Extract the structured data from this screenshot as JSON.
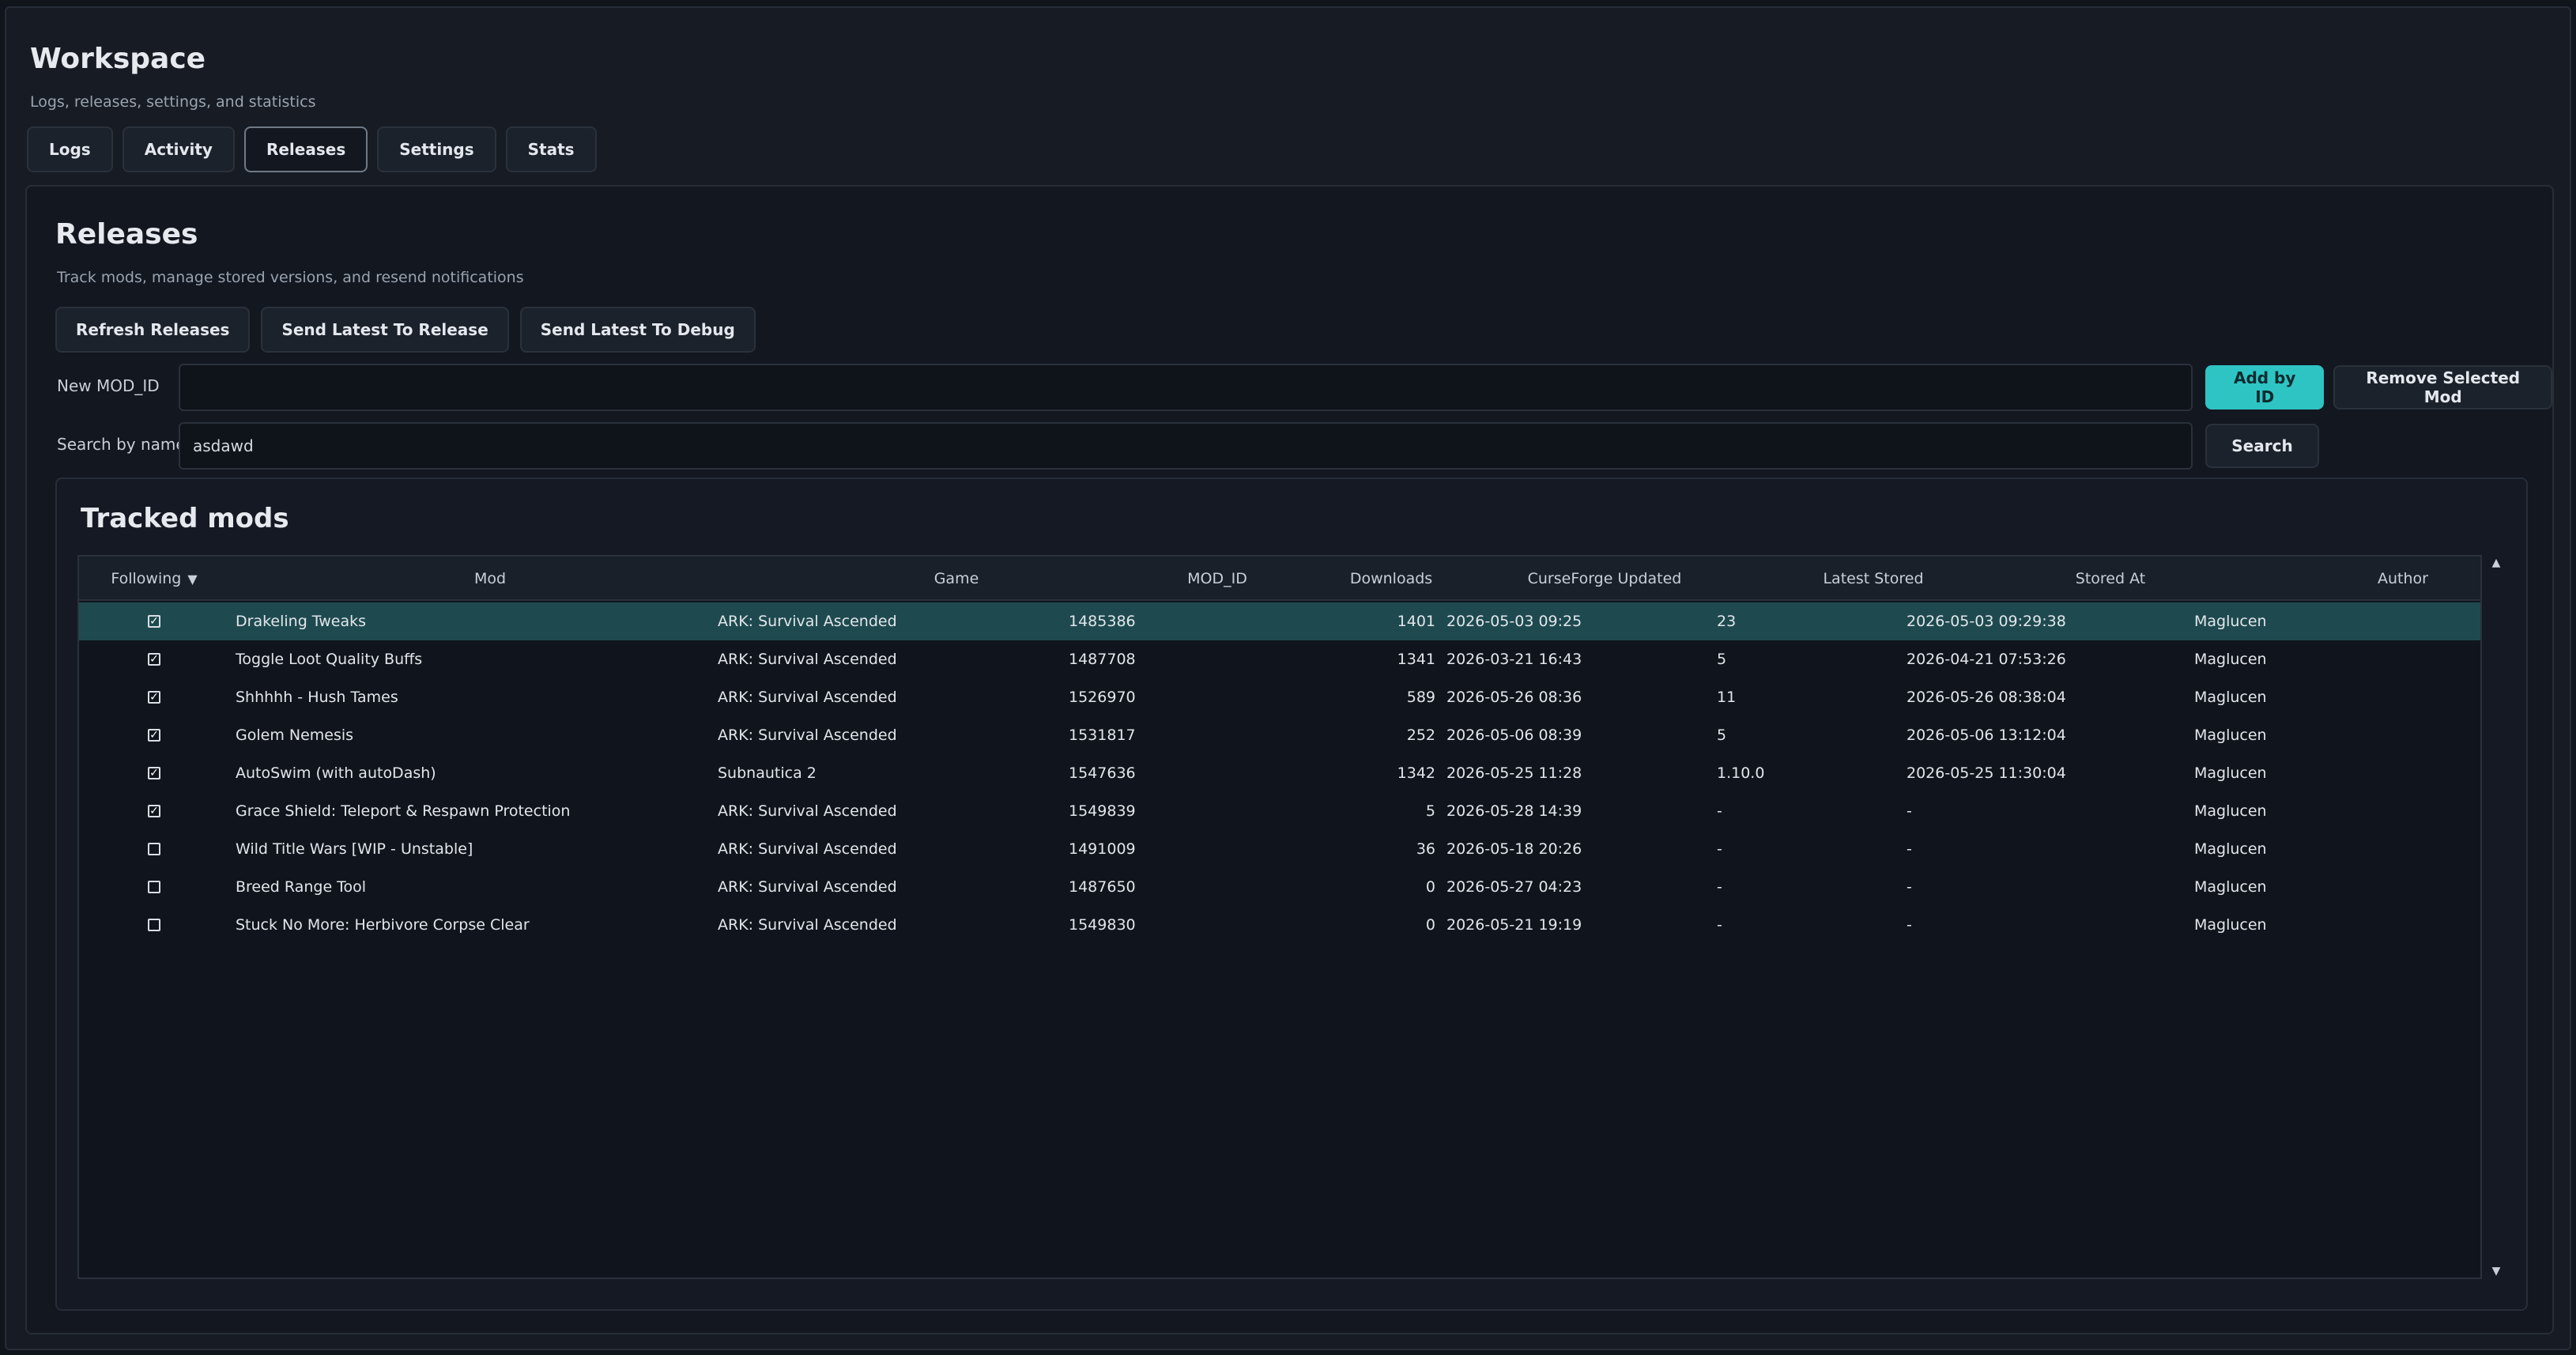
{
  "workspace": {
    "title": "Workspace",
    "subtitle": "Logs, releases, settings, and statistics"
  },
  "tabs": [
    {
      "label": "Logs",
      "active": false
    },
    {
      "label": "Activity",
      "active": false
    },
    {
      "label": "Releases",
      "active": true
    },
    {
      "label": "Settings",
      "active": false
    },
    {
      "label": "Stats",
      "active": false
    }
  ],
  "releases": {
    "title": "Releases",
    "subtitle": "Track mods, manage stored versions, and resend notifications",
    "actions": {
      "refresh": "Refresh Releases",
      "send_release": "Send Latest To Release",
      "send_debug": "Send Latest To Debug"
    },
    "new_mod": {
      "label": "New MOD_ID",
      "value": "",
      "add_button": "Add by ID",
      "remove_button": "Remove Selected Mod"
    },
    "search": {
      "label": "Search by name",
      "value": "asdawd",
      "button": "Search"
    }
  },
  "tracked": {
    "title": "Tracked mods",
    "columns": {
      "following": "Following",
      "sort_arrow": "▼",
      "mod": "Mod",
      "game": "Game",
      "mod_id": "MOD_ID",
      "downloads": "Downloads",
      "cf_updated": "CurseForge Updated",
      "latest_stored": "Latest Stored",
      "stored_at": "Stored At",
      "author": "Author"
    },
    "rows": [
      {
        "following": true,
        "mod": "Drakeling Tweaks",
        "game": "ARK: Survival Ascended",
        "mod_id": "1485386",
        "downloads": "1401",
        "cf_updated": "2026-05-03 09:25",
        "latest_stored": "23",
        "stored_at": "2026-05-03 09:29:38",
        "author": "Maglucen",
        "selected": true
      },
      {
        "following": true,
        "mod": "Toggle Loot Quality Buffs",
        "game": "ARK: Survival Ascended",
        "mod_id": "1487708",
        "downloads": "1341",
        "cf_updated": "2026-03-21 16:43",
        "latest_stored": "5",
        "stored_at": "2026-04-21 07:53:26",
        "author": "Maglucen",
        "selected": false
      },
      {
        "following": true,
        "mod": "Shhhhh - Hush Tames",
        "game": "ARK: Survival Ascended",
        "mod_id": "1526970",
        "downloads": "589",
        "cf_updated": "2026-05-26 08:36",
        "latest_stored": "11",
        "stored_at": "2026-05-26 08:38:04",
        "author": "Maglucen",
        "selected": false
      },
      {
        "following": true,
        "mod": "Golem Nemesis",
        "game": "ARK: Survival Ascended",
        "mod_id": "1531817",
        "downloads": "252",
        "cf_updated": "2026-05-06 08:39",
        "latest_stored": "5",
        "stored_at": "2026-05-06 13:12:04",
        "author": "Maglucen",
        "selected": false
      },
      {
        "following": true,
        "mod": "AutoSwim (with autoDash)",
        "game": "Subnautica 2",
        "mod_id": "1547636",
        "downloads": "1342",
        "cf_updated": "2026-05-25 11:28",
        "latest_stored": "1.10.0",
        "stored_at": "2026-05-25 11:30:04",
        "author": "Maglucen",
        "selected": false
      },
      {
        "following": true,
        "mod": "Grace Shield: Teleport & Respawn Protection",
        "game": "ARK: Survival Ascended",
        "mod_id": "1549839",
        "downloads": "5",
        "cf_updated": "2026-05-28 14:39",
        "latest_stored": "-",
        "stored_at": "-",
        "author": "Maglucen",
        "selected": false
      },
      {
        "following": false,
        "mod": "Wild Title Wars [WIP - Unstable]",
        "game": "ARK: Survival Ascended",
        "mod_id": "1491009",
        "downloads": "36",
        "cf_updated": "2026-05-18 20:26",
        "latest_stored": "-",
        "stored_at": "-",
        "author": "Maglucen",
        "selected": false
      },
      {
        "following": false,
        "mod": "Breed Range Tool",
        "game": "ARK: Survival Ascended",
        "mod_id": "1487650",
        "downloads": "0",
        "cf_updated": "2026-05-27 04:23",
        "latest_stored": "-",
        "stored_at": "-",
        "author": "Maglucen",
        "selected": false
      },
      {
        "following": false,
        "mod": "Stuck No More: Herbivore Corpse Clear",
        "game": "ARK: Survival Ascended",
        "mod_id": "1549830",
        "downloads": "0",
        "cf_updated": "2026-05-21 19:19",
        "latest_stored": "-",
        "stored_at": "-",
        "author": "Maglucen",
        "selected": false
      }
    ]
  },
  "icons": {
    "checked": "☑",
    "scroll_up": "▲",
    "scroll_down": "▼"
  }
}
